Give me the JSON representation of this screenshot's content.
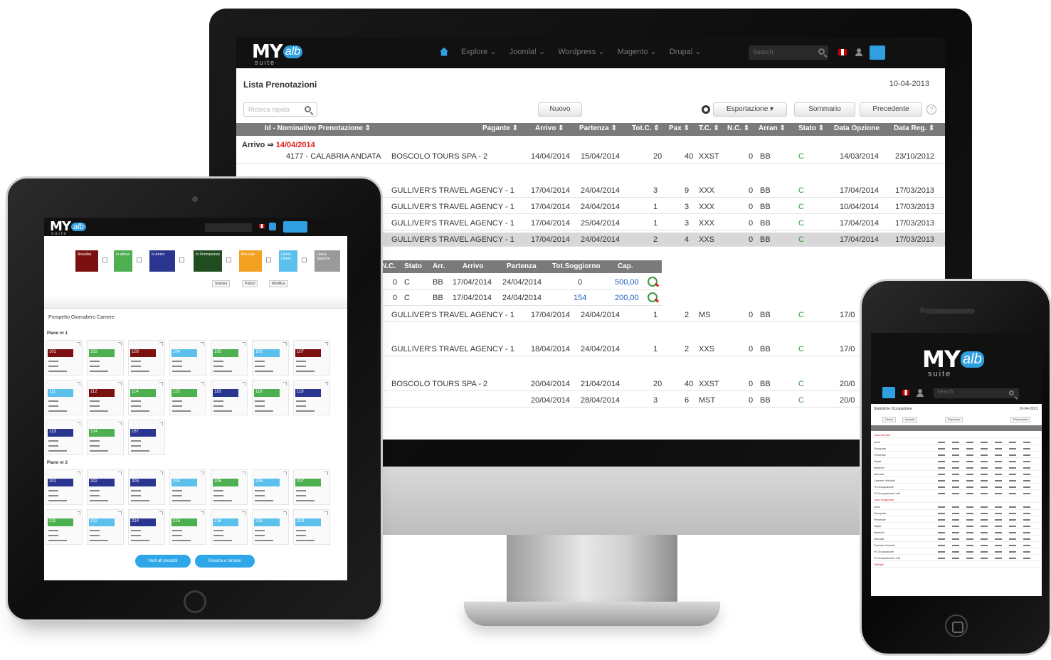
{
  "monitor": {
    "logo": {
      "my": "MY",
      "alb": "alb",
      "suite": "suite"
    },
    "menu": [
      "Explore ⌄",
      "Joomla! ⌄",
      "Wordpress ⌄",
      "Magento ⌄",
      "Drupal ⌄"
    ],
    "search_placeholder": "Search",
    "page_title": "Lista Prenotazioni",
    "date": "10-04-2013",
    "quick_search_placeholder": "Ricerca rapida",
    "buttons": {
      "nuovo": "Nuovo",
      "esportazione": "Esportazione ▾",
      "sommario": "Sommario",
      "precedente": "Precedente"
    },
    "columns": [
      "Id - Nominativo Prenotazione ⇕",
      "Pagante ⇕",
      "Arrivo ⇕",
      "Partenza ⇕",
      "Tot.C. ⇕",
      "Pax ⇕",
      "T.C. ⇕",
      "N.C. ⇕",
      "Arran ⇕",
      "Stato ⇕",
      "Data Opzione",
      "Data Reg. ⇕"
    ],
    "group_label": "Arrivo ⇒",
    "group_date": "14/04/2014",
    "rows": [
      {
        "id": "4177 - CALABRIA ANDATA",
        "pagante": "BOSCOLO TOURS SPA - 2",
        "arrivo": "14/04/2014",
        "partenza": "15/04/2014",
        "totc": "20",
        "pax": "40",
        "tc": "XXST",
        "nc": "0",
        "arr": "BB",
        "stato": "C",
        "opz": "14/03/2014",
        "reg": "23/10/2012"
      },
      {
        "id": "",
        "pagante": "GULLIVER'S TRAVEL AGENCY - 1",
        "arrivo": "17/04/2014",
        "partenza": "24/04/2014",
        "totc": "3",
        "pax": "9",
        "tc": "XXX",
        "nc": "0",
        "arr": "BB",
        "stato": "C",
        "opz": "17/04/2014",
        "reg": "17/03/2013"
      },
      {
        "id": "",
        "pagante": "GULLIVER'S TRAVEL AGENCY - 1",
        "arrivo": "17/04/2014",
        "partenza": "24/04/2014",
        "totc": "1",
        "pax": "3",
        "tc": "XXX",
        "nc": "0",
        "arr": "BB",
        "stato": "C",
        "opz": "10/04/2014",
        "reg": "17/03/2013"
      },
      {
        "id": "",
        "pagante": "GULLIVER'S TRAVEL AGENCY - 1",
        "arrivo": "17/04/2014",
        "partenza": "25/04/2014",
        "totc": "1",
        "pax": "3",
        "tc": "XXX",
        "nc": "0",
        "arr": "BB",
        "stato": "C",
        "opz": "17/04/2014",
        "reg": "17/03/2013"
      },
      {
        "id": "",
        "pagante": "GULLIVER'S TRAVEL AGENCY - 1",
        "arrivo": "17/04/2014",
        "partenza": "24/04/2014",
        "totc": "2",
        "pax": "4",
        "tc": "XXS",
        "nc": "0",
        "arr": "BB",
        "stato": "C",
        "opz": "17/04/2014",
        "reg": "17/03/2013"
      },
      {
        "id": "",
        "pagante": "GULLIVER'S TRAVEL AGENCY - 1",
        "arrivo": "17/04/2014",
        "partenza": "24/04/2014",
        "totc": "1",
        "pax": "2",
        "tc": "MS",
        "nc": "0",
        "arr": "BB",
        "stato": "C",
        "opz": "17/0",
        "reg": ""
      },
      {
        "id": "",
        "pagante": "GULLIVER'S TRAVEL AGENCY - 1",
        "arrivo": "18/04/2014",
        "partenza": "24/04/2014",
        "totc": "1",
        "pax": "2",
        "tc": "XXS",
        "nc": "0",
        "arr": "BB",
        "stato": "C",
        "opz": "17/0",
        "reg": ""
      },
      {
        "id": "",
        "pagante": "BOSCOLO TOURS SPA - 2",
        "arrivo": "20/04/2014",
        "partenza": "21/04/2014",
        "totc": "20",
        "pax": "40",
        "tc": "XXST",
        "nc": "0",
        "arr": "BB",
        "stato": "C",
        "opz": "20/0",
        "reg": ""
      },
      {
        "id": "",
        "pagante": "",
        "arrivo": "20/04/2014",
        "partenza": "28/04/2014",
        "totc": "3",
        "pax": "6",
        "tc": "MST",
        "nc": "0",
        "arr": "BB",
        "stato": "C",
        "opz": "20/0",
        "reg": ""
      }
    ],
    "sub_columns": [
      "N.C.",
      "Stato",
      "Arr.",
      "Arrivo",
      "Partenza",
      "Tot.Soggiorno",
      "Cap."
    ],
    "sub_rows": [
      {
        "nc": "0",
        "stato": "C",
        "arr": "BB",
        "arrivo": "17/04/2014",
        "partenza": "24/04/2014",
        "tot": "0",
        "cap": "500,00"
      },
      {
        "nc": "0",
        "stato": "C",
        "arr": "BB",
        "arrivo": "17/04/2014",
        "partenza": "24/04/2014",
        "tot": "154",
        "cap": "200,00"
      }
    ]
  },
  "tablet": {
    "logo": {
      "my": "MY",
      "alb": "alb",
      "suite": "suite"
    },
    "legend": [
      {
        "label": "Annullati",
        "color": "#7a1010"
      },
      {
        "label": "In attesa",
        "color": "#4caf50"
      },
      {
        "label": "In Arrivo",
        "color": "#2a3590"
      },
      {
        "label": "In Permanenza",
        "color": "#1f4d1f"
      },
      {
        "label": "Bloccate",
        "color": "#f4a020"
      },
      {
        "label": "Libere Libere",
        "color": "#5bc0eb"
      },
      {
        "label": "Libere Sporche",
        "color": "#9a9a9a"
      }
    ],
    "small_buttons": [
      "Stampa",
      "Pulisci",
      "Modifica"
    ],
    "prospect_title": "Prospetto Giornaliero Camere",
    "floor1": "Piano nr 1",
    "floor2": "Piano nr 2",
    "rooms_floor1": [
      {
        "n": "101",
        "c": "#7a1010"
      },
      {
        "n": "102",
        "c": "#4caf50"
      },
      {
        "n": "103",
        "c": "#7a1010"
      },
      {
        "n": "104",
        "c": "#5bc0eb"
      },
      {
        "n": "105",
        "c": "#4caf50"
      },
      {
        "n": "106",
        "c": "#5bc0eb"
      },
      {
        "n": "107",
        "c": "#7a1010"
      },
      {
        "n": "111",
        "c": "#5bc0eb"
      },
      {
        "n": "112",
        "c": "#7a1010"
      },
      {
        "n": "114",
        "c": "#4caf50"
      },
      {
        "n": "115",
        "c": "#4caf50"
      },
      {
        "n": "116",
        "c": "#2a3590"
      },
      {
        "n": "118",
        "c": "#4caf50"
      },
      {
        "n": "119",
        "c": "#2a3590"
      },
      {
        "n": "123",
        "c": "#2a3590"
      },
      {
        "n": "124",
        "c": "#4caf50"
      },
      {
        "n": "167",
        "c": "#2a3590"
      }
    ],
    "rooms_floor2": [
      {
        "n": "201",
        "c": "#2a3590"
      },
      {
        "n": "202",
        "c": "#2a3590"
      },
      {
        "n": "203",
        "c": "#2a3590"
      },
      {
        "n": "204",
        "c": "#5bc0eb"
      },
      {
        "n": "205",
        "c": "#4caf50"
      },
      {
        "n": "206",
        "c": "#5bc0eb"
      },
      {
        "n": "207",
        "c": "#4caf50"
      },
      {
        "n": "211",
        "c": "#4caf50"
      },
      {
        "n": "212",
        "c": "#5bc0eb"
      },
      {
        "n": "214",
        "c": "#2a3590"
      },
      {
        "n": "215",
        "c": "#4caf50"
      },
      {
        "n": "216",
        "c": "#5bc0eb"
      },
      {
        "n": "218",
        "c": "#5bc0eb"
      },
      {
        "n": "219",
        "c": "#5bc0eb"
      }
    ],
    "pill_buttons": [
      "Vedi all prodotti",
      "Ricerca e tornare"
    ]
  },
  "phone": {
    "logo": {
      "my": "MY",
      "alb": "alb",
      "suite": "suite"
    },
    "search_placeholder": "Search",
    "title": "Statistiche Occupazione",
    "date": "10-04-2013",
    "buttons": [
      "Cerca",
      "Annulla",
      "Esportare",
      "Precedente"
    ],
    "section1": "Lista Mensile",
    "section2": "Lista Stagionale",
    "section3": "Dettagli",
    "rows": [
      "Arrivi",
      "Occupate",
      "Presenze",
      "Ospiti",
      "Bambini",
      "Neonati",
      "Camere Vendute",
      "% Occupazione",
      "% Occupazione Letti"
    ]
  },
  "colors": {
    "brand_blue": "#2f9fe0",
    "header_gray": "#7a7a7a",
    "arrival_red": "#e21d1d",
    "status_green": "#2e9f2e"
  }
}
